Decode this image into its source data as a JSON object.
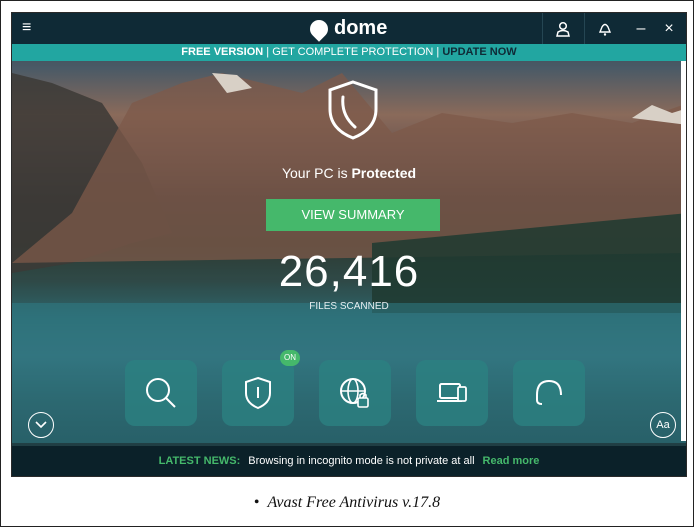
{
  "titlebar": {
    "logo_text": "dome",
    "menu_icon": "hamburger-icon",
    "user_icon": "user-icon",
    "notification_icon": "bell-icon",
    "minimize": "–",
    "close": "×"
  },
  "banner": {
    "free_version": "FREE VERSION",
    "sep1": " | ",
    "get_protection": "GET COMPLETE PROTECTION",
    "sep2": " | ",
    "update_now": "UPDATE NOW"
  },
  "status": {
    "prefix": "Your PC is ",
    "state": "Protected"
  },
  "view_summary_label": "VIEW SUMMARY",
  "files_scanned": {
    "count": "26,416",
    "label": "FILES SCANNED"
  },
  "tiles": [
    {
      "icon": "search-icon"
    },
    {
      "icon": "shield-icon",
      "badge": "ON"
    },
    {
      "icon": "globe-lock-icon"
    },
    {
      "icon": "devices-icon"
    },
    {
      "icon": "headset-icon"
    }
  ],
  "expand_icon": "chevron-down-icon",
  "font_button_label": "Aa",
  "news": {
    "tag": "LATEST NEWS:",
    "headline": "Browsing in incognito mode is not private at all",
    "link": "Read more"
  },
  "caption": {
    "bullet": "•",
    "text": "Avast Free Antivirus v.17.8"
  },
  "colors": {
    "accent_teal": "#22a6a1",
    "accent_green": "#45b86b",
    "titlebar_bg": "#0f2a36"
  }
}
